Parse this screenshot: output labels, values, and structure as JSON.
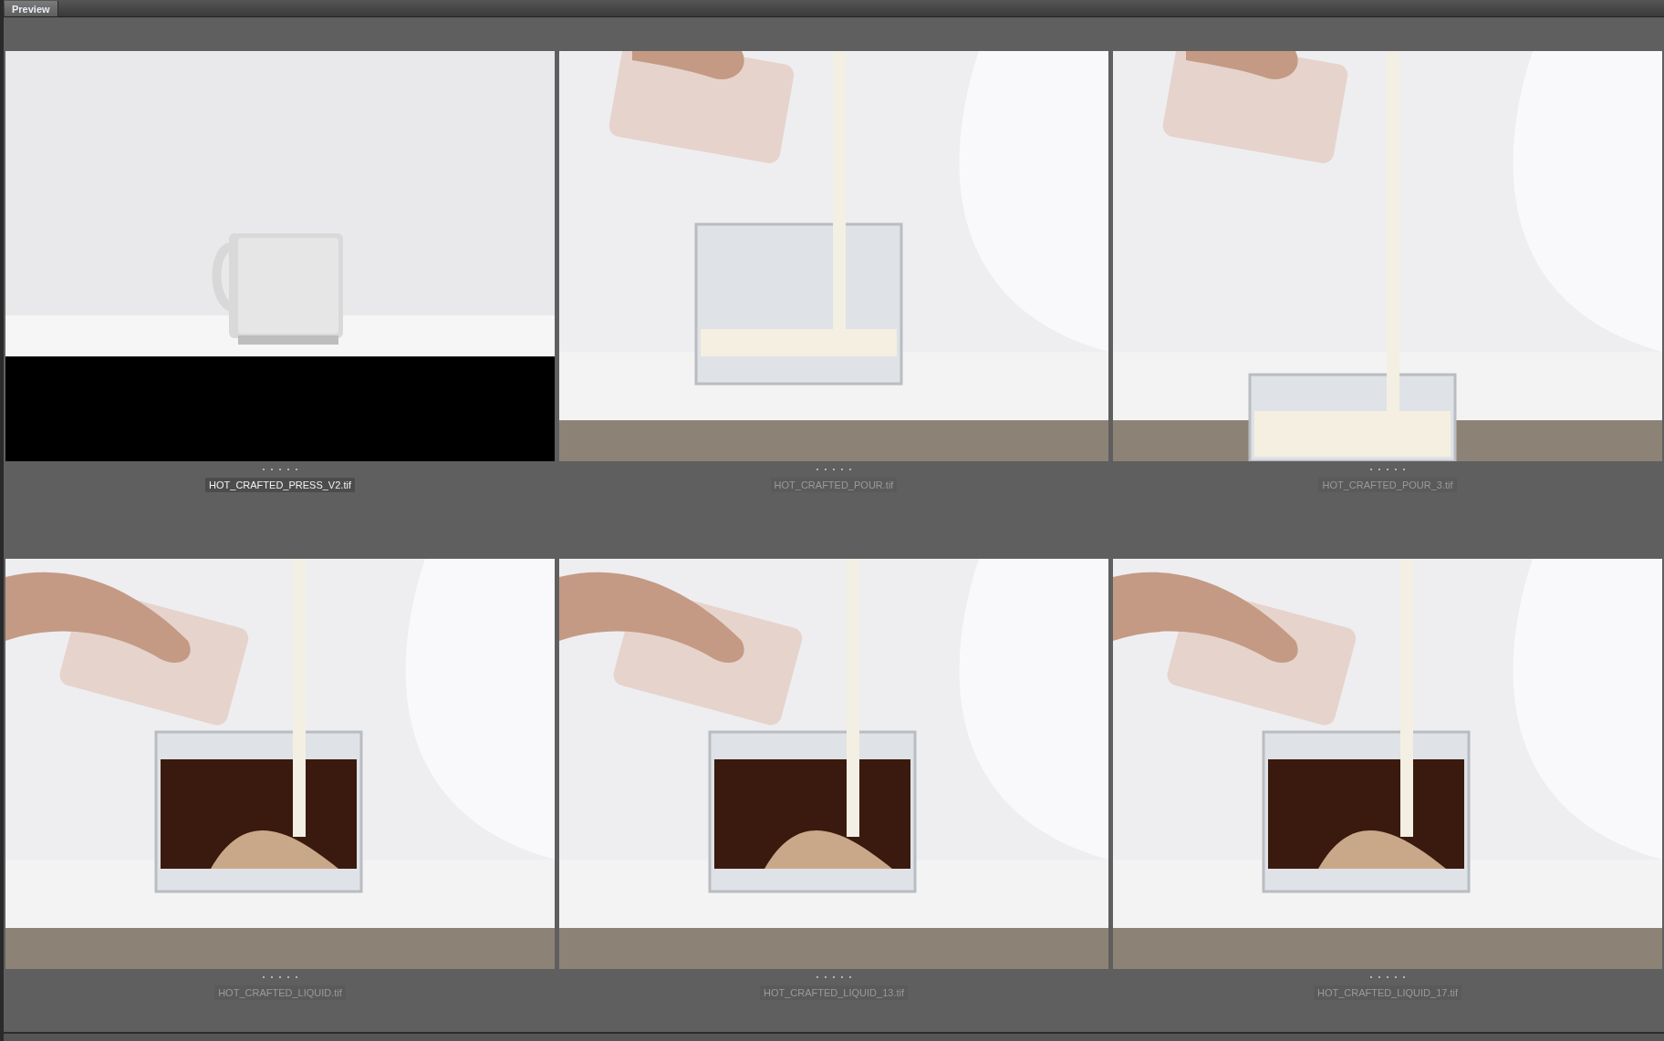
{
  "tabs": [
    {
      "label": "Preview",
      "selected": true
    }
  ],
  "thumbnails": [
    {
      "filename": "HOT_CRAFTED_PRESS_V2.tif",
      "selected": true,
      "stars": 0
    },
    {
      "filename": "HOT_CRAFTED_POUR.tif",
      "selected": false,
      "stars": 0
    },
    {
      "filename": "HOT_CRAFTED_POUR_3.tif",
      "selected": false,
      "stars": 0
    },
    {
      "filename": "HOT_CRAFTED_LIQUID.tif",
      "selected": false,
      "stars": 0
    },
    {
      "filename": "HOT_CRAFTED_LIQUID_13.tif",
      "selected": false,
      "stars": 0
    },
    {
      "filename": "HOT_CRAFTED_LIQUID_17.tif",
      "selected": false,
      "stars": 0
    }
  ]
}
